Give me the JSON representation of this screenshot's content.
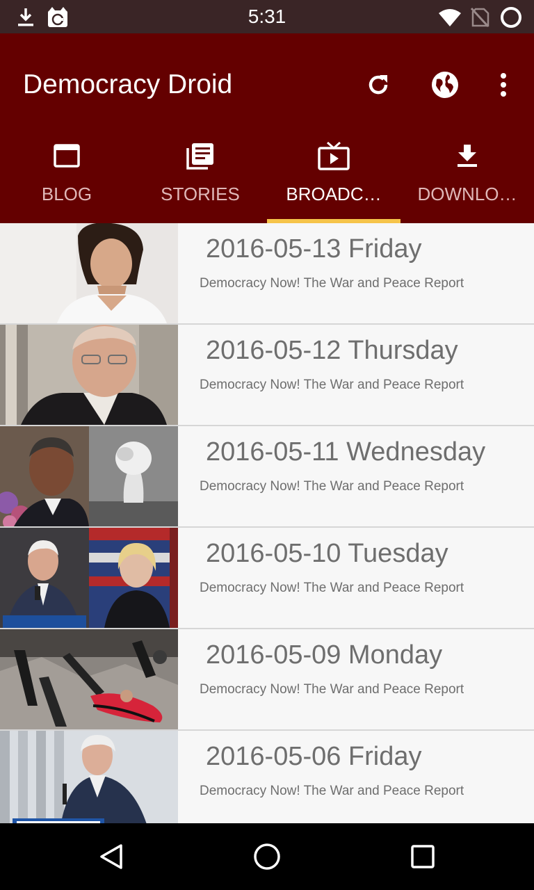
{
  "status_bar": {
    "time": "5:31",
    "icons": [
      "download-notification-icon",
      "app-notification-icon",
      "wifi-icon",
      "no-sim-icon",
      "battery-circle-icon"
    ]
  },
  "app_bar": {
    "title": "Democracy Droid",
    "actions": [
      "refresh-icon",
      "globe-icon",
      "more-vert-icon"
    ]
  },
  "tabs": [
    {
      "label": "BLOG",
      "icon": "blog-window-icon",
      "active": false
    },
    {
      "label": "STORIES",
      "icon": "stories-list-icon",
      "active": false
    },
    {
      "label": "BROADC…",
      "icon": "tv-play-icon",
      "active": true
    },
    {
      "label": "DOWNLO…",
      "icon": "download-icon",
      "active": false
    }
  ],
  "colors": {
    "status_bar": "#3a2526",
    "app_bar": "#640000",
    "tab_indicator": "#f6c44a",
    "list_background": "#f7f7f7",
    "row_text": "#6e6e6e"
  },
  "broadcasts": [
    {
      "title": "2016-05-13 Friday",
      "subtitle": "Democracy Now! The War and Peace Report"
    },
    {
      "title": "2016-05-12 Thursday",
      "subtitle": "Democracy Now! The War and Peace Report"
    },
    {
      "title": "2016-05-11 Wednesday",
      "subtitle": "Democracy Now! The War and Peace Report"
    },
    {
      "title": "2016-05-10 Tuesday",
      "subtitle": "Democracy Now! The War and Peace Report"
    },
    {
      "title": "2016-05-09 Monday",
      "subtitle": "Democracy Now! The War and Peace Report"
    },
    {
      "title": "2016-05-06 Friday",
      "subtitle": "Democracy Now! The War and Peace Report"
    }
  ],
  "nav_bar": {
    "buttons": [
      "back-icon",
      "home-icon",
      "recents-icon"
    ]
  }
}
